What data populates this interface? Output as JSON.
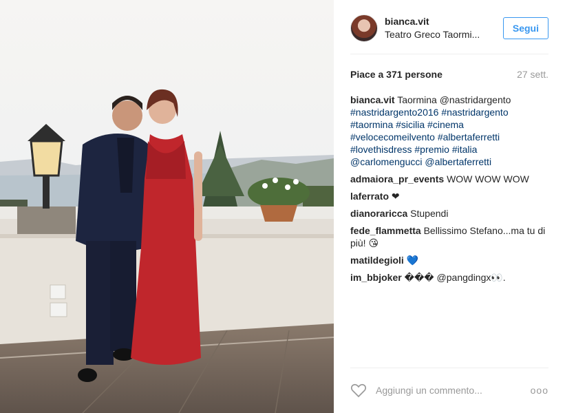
{
  "header": {
    "username": "bianca.vit",
    "location": "Teatro Greco Taormi...",
    "follow_label": "Segui"
  },
  "likes": {
    "text": "Piace a 371 persone",
    "time": "27 sett."
  },
  "caption": {
    "user": "bianca.vit",
    "lines": [
      "Taormina @nastridargento",
      "#nastridargento2016 #nastridargento",
      "#taormina #sicilia #cinema",
      "#velocecomeilvento #albertaferretti",
      "#lovethisdress #premio #italia",
      "@carlomengucci @albertaferretti"
    ]
  },
  "comments": [
    {
      "user": "admaiora_pr_events",
      "text": "WOW WOW WOW"
    },
    {
      "user": "laferrato",
      "text": "❤"
    },
    {
      "user": "dianoraricca",
      "text": "Stupendi"
    },
    {
      "user": "fede_flammetta",
      "text": "Bellissimo Stefano...ma tu di più! 😘"
    },
    {
      "user": "matildegioli",
      "text": "💙"
    },
    {
      "user": "im_bbjoker",
      "text": "��� @pangdingx👀."
    }
  ],
  "footer": {
    "comment_placeholder": "Aggiungi un commento...",
    "more_label": "ooo",
    "heart_icon": "heart-outline-icon"
  },
  "colors": {
    "accent": "#3897f0",
    "link": "#003569",
    "muted": "#999999",
    "dress": "#c0262c"
  }
}
